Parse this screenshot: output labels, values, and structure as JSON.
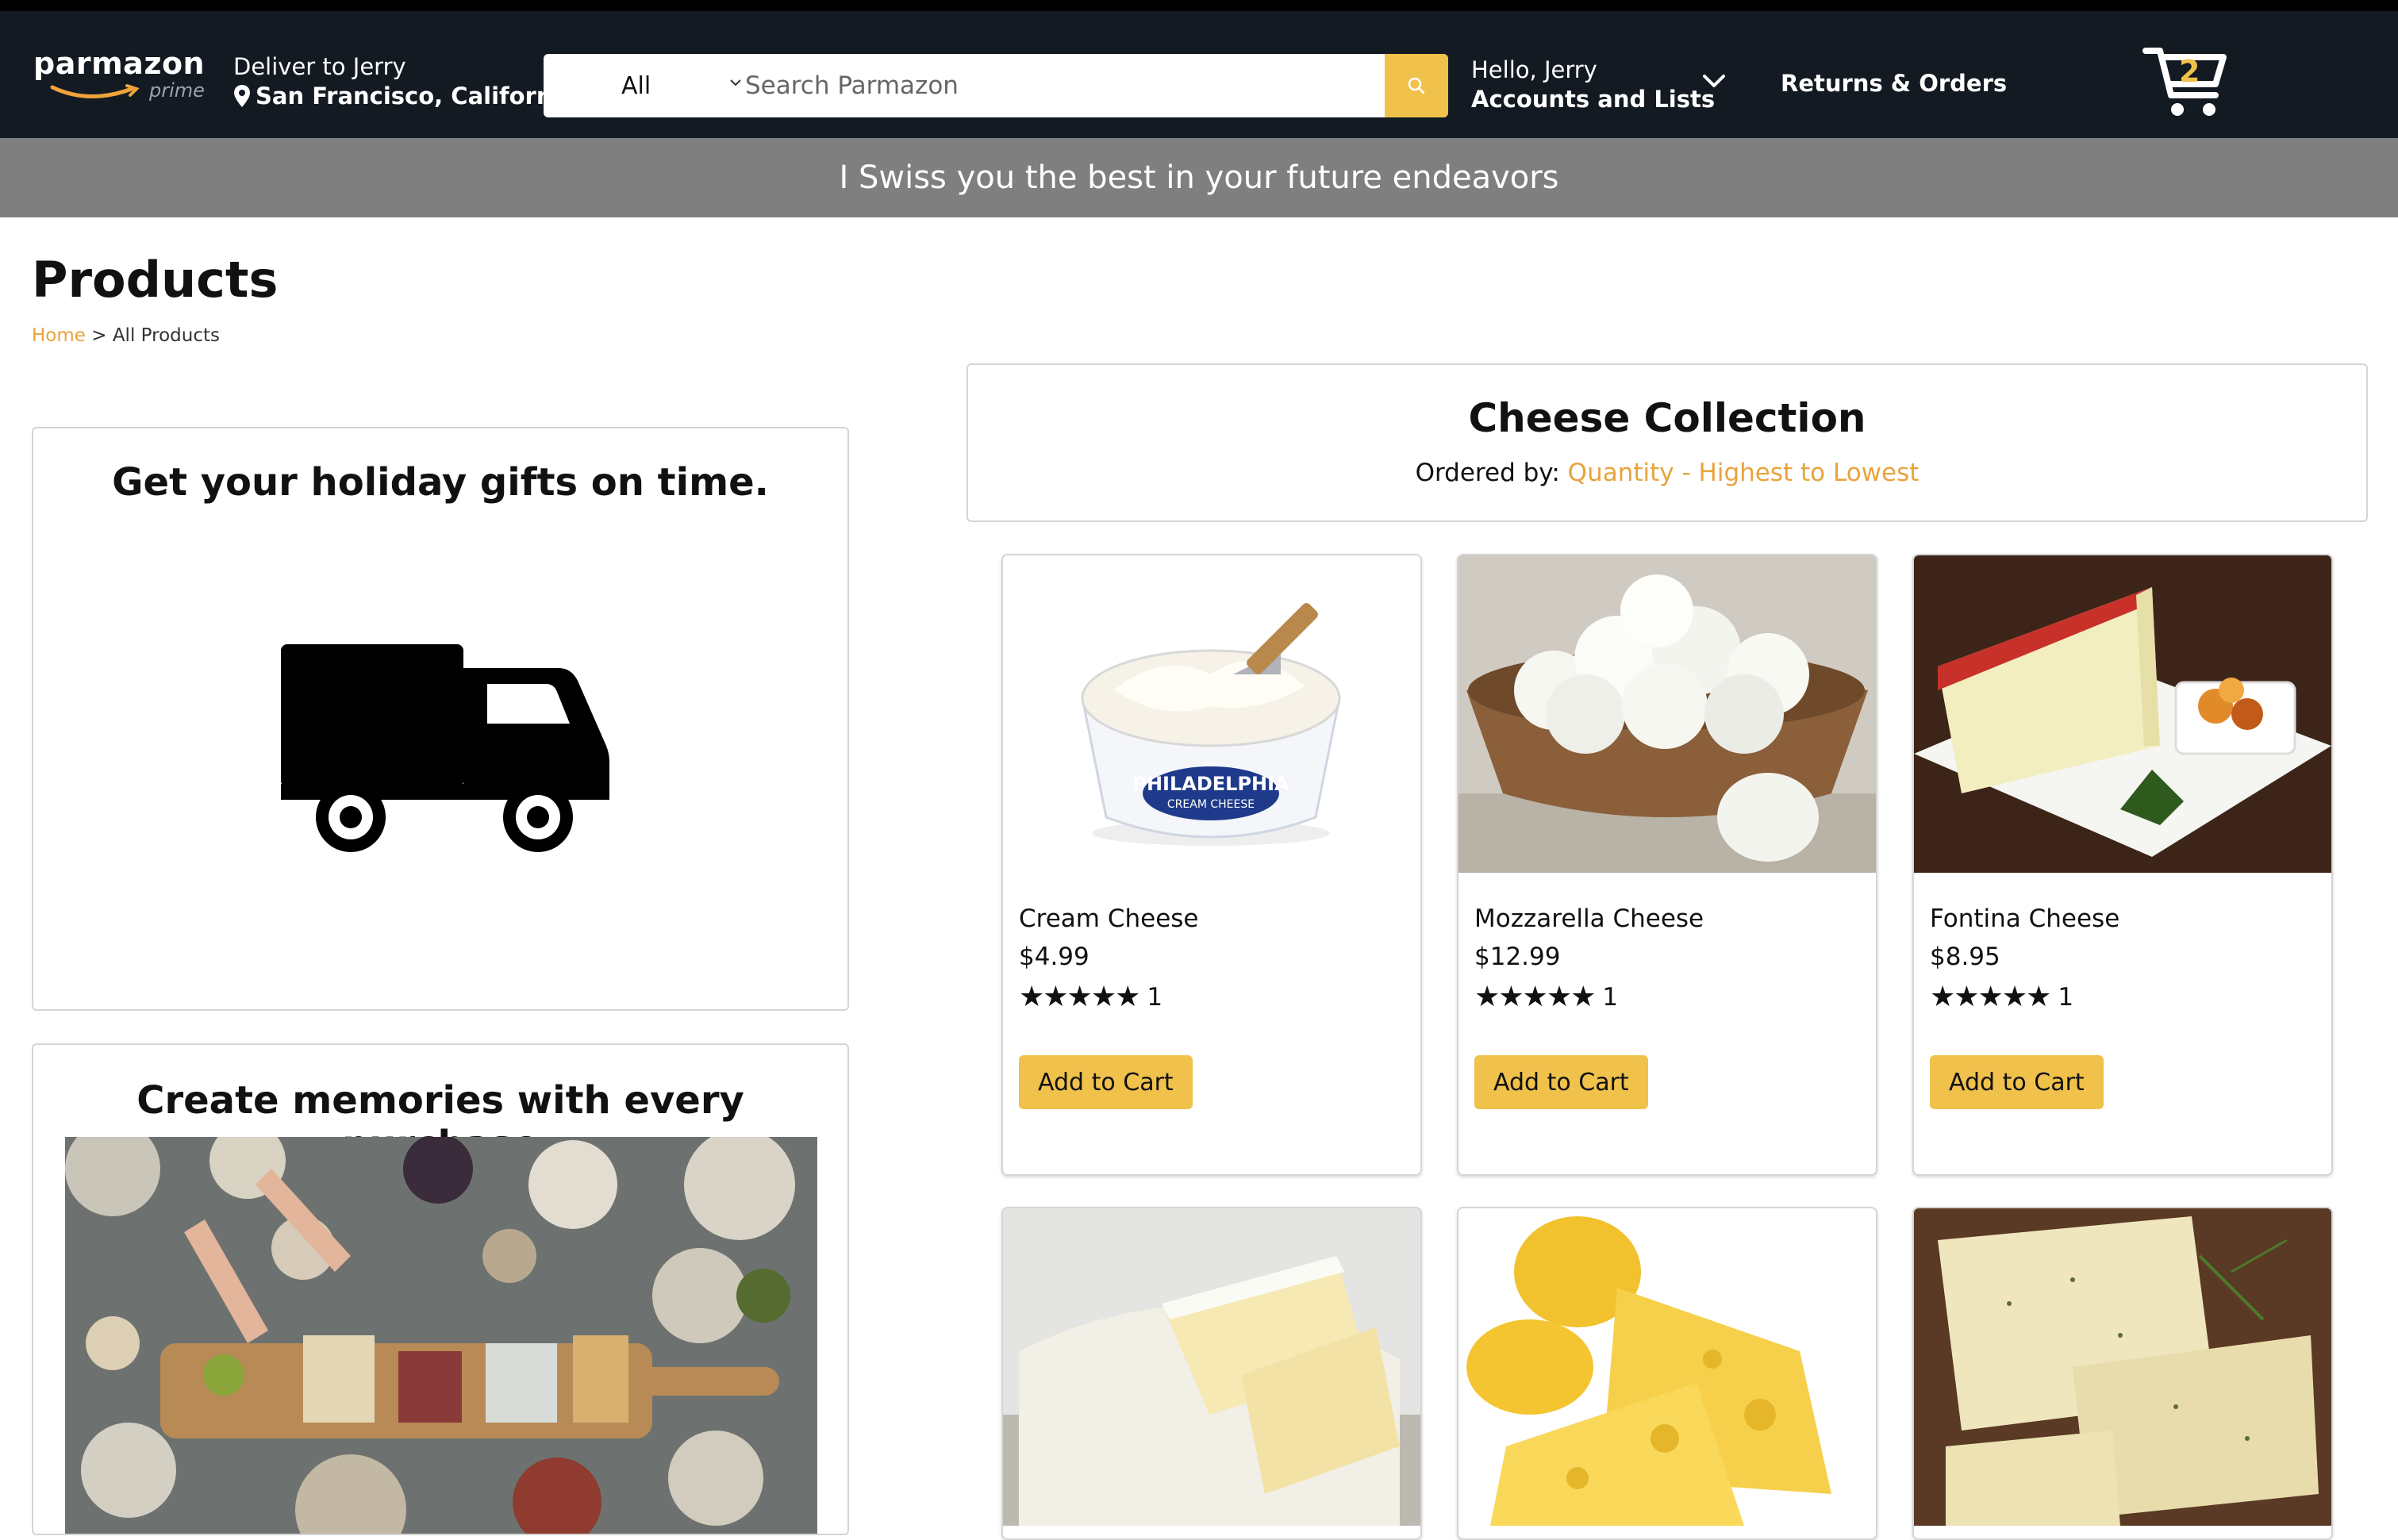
{
  "header": {
    "logo_text": "parmazon",
    "logo_sub": "prime",
    "deliver_line1": "Deliver to Jerry",
    "deliver_line2": "San Francisco, California",
    "search_category": "All",
    "search_placeholder": "Search Parmazon",
    "account_line1": "Hello, Jerry",
    "account_line2": "Accounts and Lists",
    "returns_label": "Returns & Orders",
    "cart_count": "2"
  },
  "banner_text": "I Swiss you the best in your future endeavors",
  "page": {
    "title": "Products",
    "breadcrumb_home": "Home",
    "breadcrumb_sep": " > ",
    "breadcrumb_current": "All Products"
  },
  "promos": {
    "holiday_title": "Get your holiday gifts on time.",
    "memories_title": "Create memories with every purchase"
  },
  "collection": {
    "title": "Cheese Collection",
    "order_label": "Ordered by: ",
    "order_value": "Quantity - Highest to Lowest"
  },
  "products": [
    {
      "name": "Cream Cheese",
      "price": "$4.99",
      "stars": "★★★★★",
      "rating_count": "1",
      "button": "Add to Cart"
    },
    {
      "name": "Mozzarella Cheese",
      "price": "$12.99",
      "stars": "★★★★★",
      "rating_count": "1",
      "button": "Add to Cart"
    },
    {
      "name": "Fontina Cheese",
      "price": "$8.95",
      "stars": "★★★★★",
      "rating_count": "1",
      "button": "Add to Cart"
    }
  ],
  "colors": {
    "header_bg": "#131a22",
    "banner_bg": "#7f7f7f",
    "accent": "#f0c14b",
    "link_orange": "#e8a33d"
  }
}
